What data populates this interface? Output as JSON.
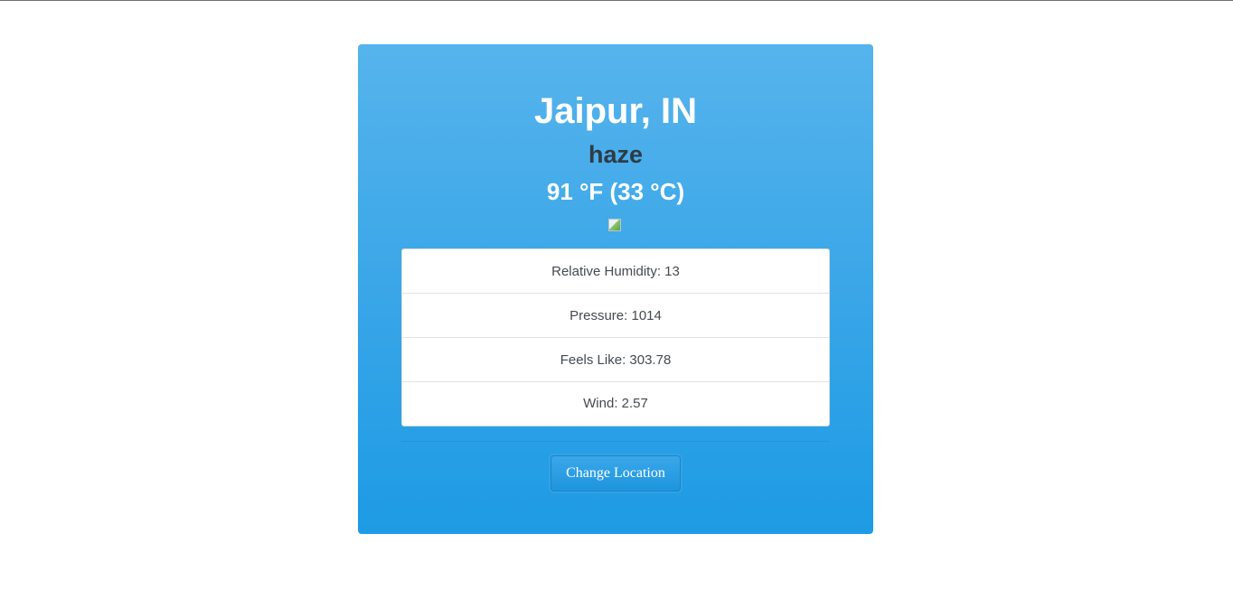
{
  "weather": {
    "location": "Jaipur, IN",
    "condition": "haze",
    "temperature": "91 °F (33 °C)",
    "icon": "broken-image-icon"
  },
  "details": [
    {
      "label": "Relative Humidity: 13"
    },
    {
      "label": "Pressure: 1014"
    },
    {
      "label": "Feels Like: 303.78"
    },
    {
      "label": "Wind: 2.57"
    }
  ],
  "actions": {
    "change_location_label": "Change Location"
  },
  "colors": {
    "card_top": "#56b4ec",
    "card_bottom": "#1d9be4",
    "title_text": "#ffffff",
    "condition_text": "#2f3b45",
    "button": "#2a9ee3"
  }
}
